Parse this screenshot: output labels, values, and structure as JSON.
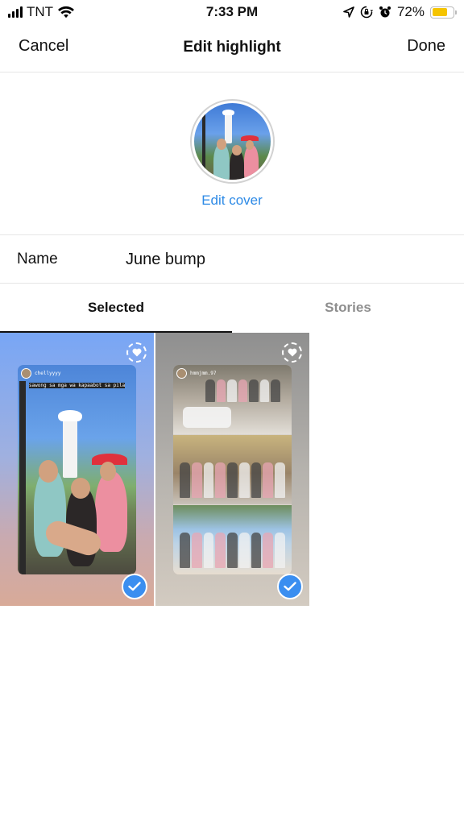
{
  "status_bar": {
    "carrier": "TNT",
    "time": "7:33 PM",
    "battery_percent": "72%",
    "battery_level": 0.72,
    "icons": [
      "signal-icon",
      "wifi-icon",
      "location-icon",
      "orientation-lock-icon",
      "alarm-icon",
      "battery-icon"
    ]
  },
  "nav": {
    "cancel_label": "Cancel",
    "title": "Edit highlight",
    "done_label": "Done"
  },
  "cover": {
    "edit_label": "Edit cover"
  },
  "name_field": {
    "label": "Name",
    "value": "June bump"
  },
  "tabs": [
    {
      "label": "Selected",
      "active": true
    },
    {
      "label": "Stories",
      "active": false
    }
  ],
  "stories": [
    {
      "username": "chellyyyy",
      "caption": "sawong sa mga wa kapaabot sa pila",
      "selected": true,
      "badges": [
        "heart-icon",
        "checkmark-icon"
      ]
    },
    {
      "username": "hmmjmm.97",
      "caption": "",
      "selected": true,
      "badges": [
        "heart-icon",
        "checkmark-icon"
      ]
    }
  ],
  "colors": {
    "accent": "#2d8ae6",
    "check_badge": "#3a8ef0",
    "battery": "#f5c400",
    "inactive_tab": "#8e8e8e",
    "divider": "#e6e6e6"
  }
}
